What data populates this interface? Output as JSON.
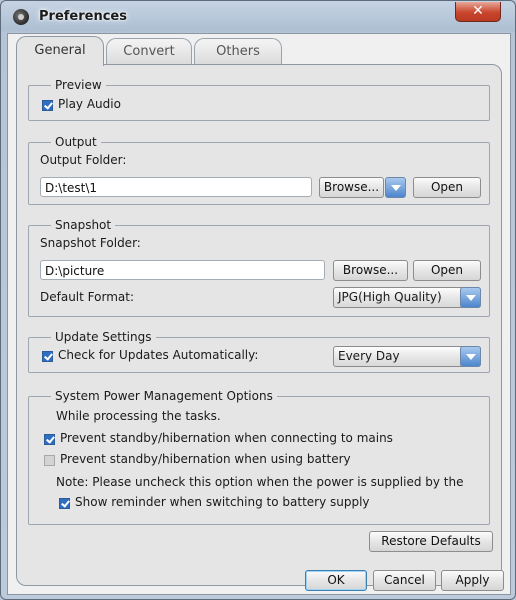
{
  "window": {
    "title": "Preferences",
    "close_label": "✕"
  },
  "tabs": [
    {
      "label": "General"
    },
    {
      "label": "Convert"
    },
    {
      "label": "Others"
    }
  ],
  "preview": {
    "legend": "Preview",
    "play_audio_label": "Play Audio",
    "play_audio_checked": true
  },
  "output": {
    "legend": "Output",
    "folder_label": "Output Folder:",
    "folder_value": "D:\\test\\1",
    "browse_label": "Browse...",
    "open_label": "Open"
  },
  "snapshot": {
    "legend": "Snapshot",
    "folder_label": "Snapshot Folder:",
    "folder_value": "D:\\picture",
    "browse_label": "Browse...",
    "open_label": "Open",
    "format_label": "Default Format:",
    "format_value": "JPG(High Quality)"
  },
  "update": {
    "legend": "Update Settings",
    "check_label": "Check for Updates Automatically:",
    "check_checked": true,
    "frequency_value": "Every Day"
  },
  "power": {
    "legend": "System Power Management Options",
    "intro": "While processing the tasks.",
    "mains_label": "Prevent standby/hibernation when connecting to mains",
    "mains_checked": true,
    "battery_label": "Prevent standby/hibernation when using battery",
    "battery_checked": false,
    "note": "Note: Please uncheck this option when the power is supplied by the",
    "reminder_label": "Show reminder when switching to battery supply",
    "reminder_checked": true
  },
  "footer": {
    "restore_label": "Restore Defaults",
    "ok_label": "OK",
    "cancel_label": "Cancel",
    "apply_label": "Apply"
  }
}
